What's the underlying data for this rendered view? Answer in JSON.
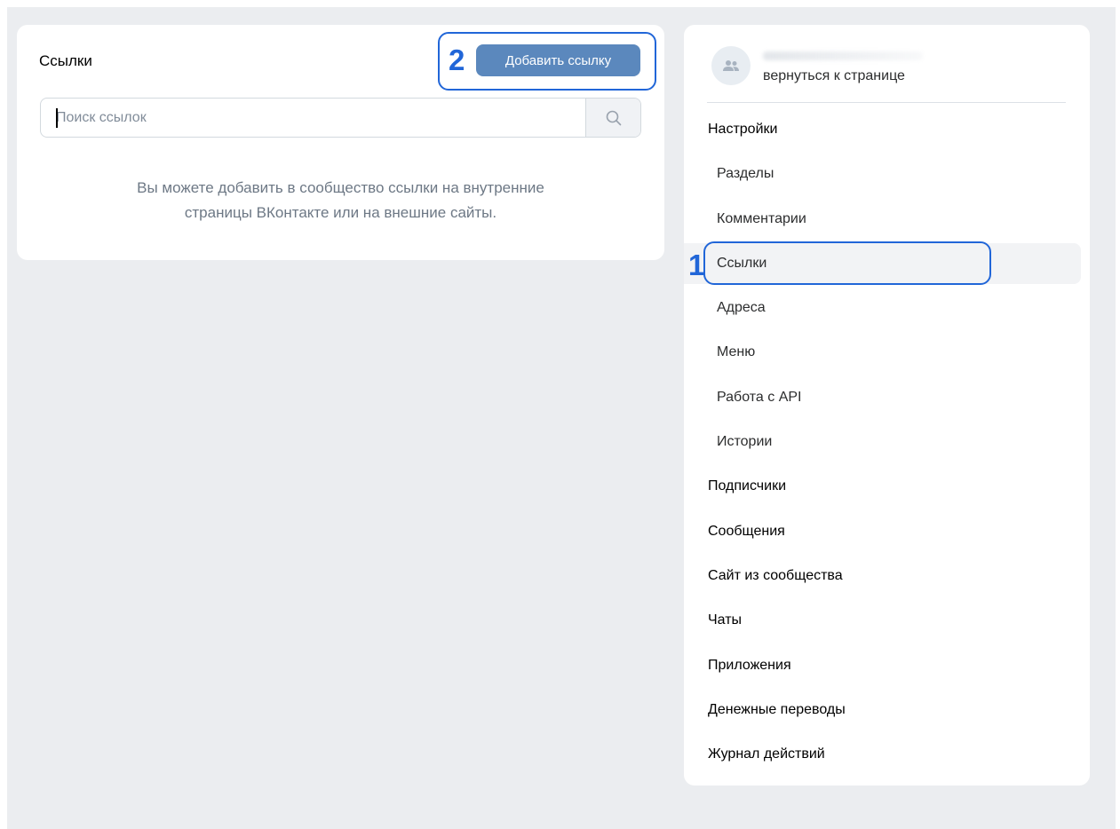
{
  "links_card": {
    "title": "Ссылки",
    "add_button": "Добавить ссылку",
    "search_placeholder": "Поиск ссылок",
    "empty_line1": "Вы можете добавить в сообщество ссылки на внутренние",
    "empty_line2": "страницы ВКонтакте или на внешние сайты."
  },
  "annotations": {
    "step1": "1",
    "step2": "2"
  },
  "menu": {
    "back_link": "вернуться к странице",
    "items": [
      {
        "label": "Настройки",
        "level": "top"
      },
      {
        "label": "Разделы",
        "level": "sub"
      },
      {
        "label": "Комментарии",
        "level": "sub"
      },
      {
        "label": "Ссылки",
        "level": "sub",
        "active": true
      },
      {
        "label": "Адреса",
        "level": "sub"
      },
      {
        "label": "Меню",
        "level": "sub"
      },
      {
        "label": "Работа с API",
        "level": "sub"
      },
      {
        "label": "Истории",
        "level": "sub"
      },
      {
        "label": "Подписчики",
        "level": "top"
      },
      {
        "label": "Сообщения",
        "level": "top"
      },
      {
        "label": "Сайт из сообщества",
        "level": "top"
      },
      {
        "label": "Чаты",
        "level": "top"
      },
      {
        "label": "Приложения",
        "level": "top"
      },
      {
        "label": "Денежные переводы",
        "level": "top"
      },
      {
        "label": "Журнал действий",
        "level": "top"
      }
    ]
  },
  "icons": {
    "search": "search-icon",
    "avatar": "group-avatar-icon"
  },
  "colors": {
    "accent_button": "#5b88bd",
    "annotation": "#2166d8",
    "background": "#ebedf0"
  }
}
